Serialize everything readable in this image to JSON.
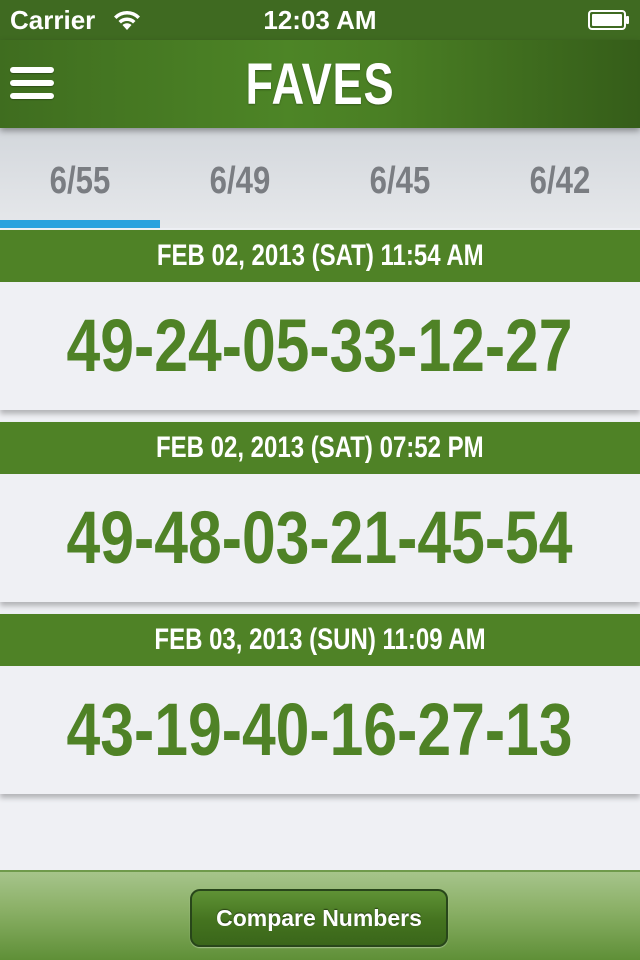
{
  "status_bar": {
    "carrier": "Carrier",
    "time": "12:03 AM",
    "icons": [
      "wifi-icon",
      "battery-icon"
    ]
  },
  "nav": {
    "title": "FAVES",
    "menu_icon": "hamburger-menu-icon"
  },
  "tabs": [
    {
      "label": "6/55",
      "selected": true
    },
    {
      "label": "6/49",
      "selected": false
    },
    {
      "label": "6/45",
      "selected": false
    },
    {
      "label": "6/42",
      "selected": false
    }
  ],
  "favorites": [
    {
      "date": "FEB 02, 2013 (SAT) 11:54 AM",
      "numbers": "49-24-05-33-12-27"
    },
    {
      "date": "FEB 02, 2013 (SAT) 07:52 PM",
      "numbers": "49-48-03-21-45-54"
    },
    {
      "date": "FEB 03, 2013 (SUN) 11:09 AM",
      "numbers": "43-19-40-16-27-13"
    }
  ],
  "toolbar": {
    "compare_label": "Compare Numbers"
  },
  "colors": {
    "brand_green": "#4f8226",
    "tab_indicator": "#2aa2de",
    "tab_text": "#7a7d82"
  }
}
